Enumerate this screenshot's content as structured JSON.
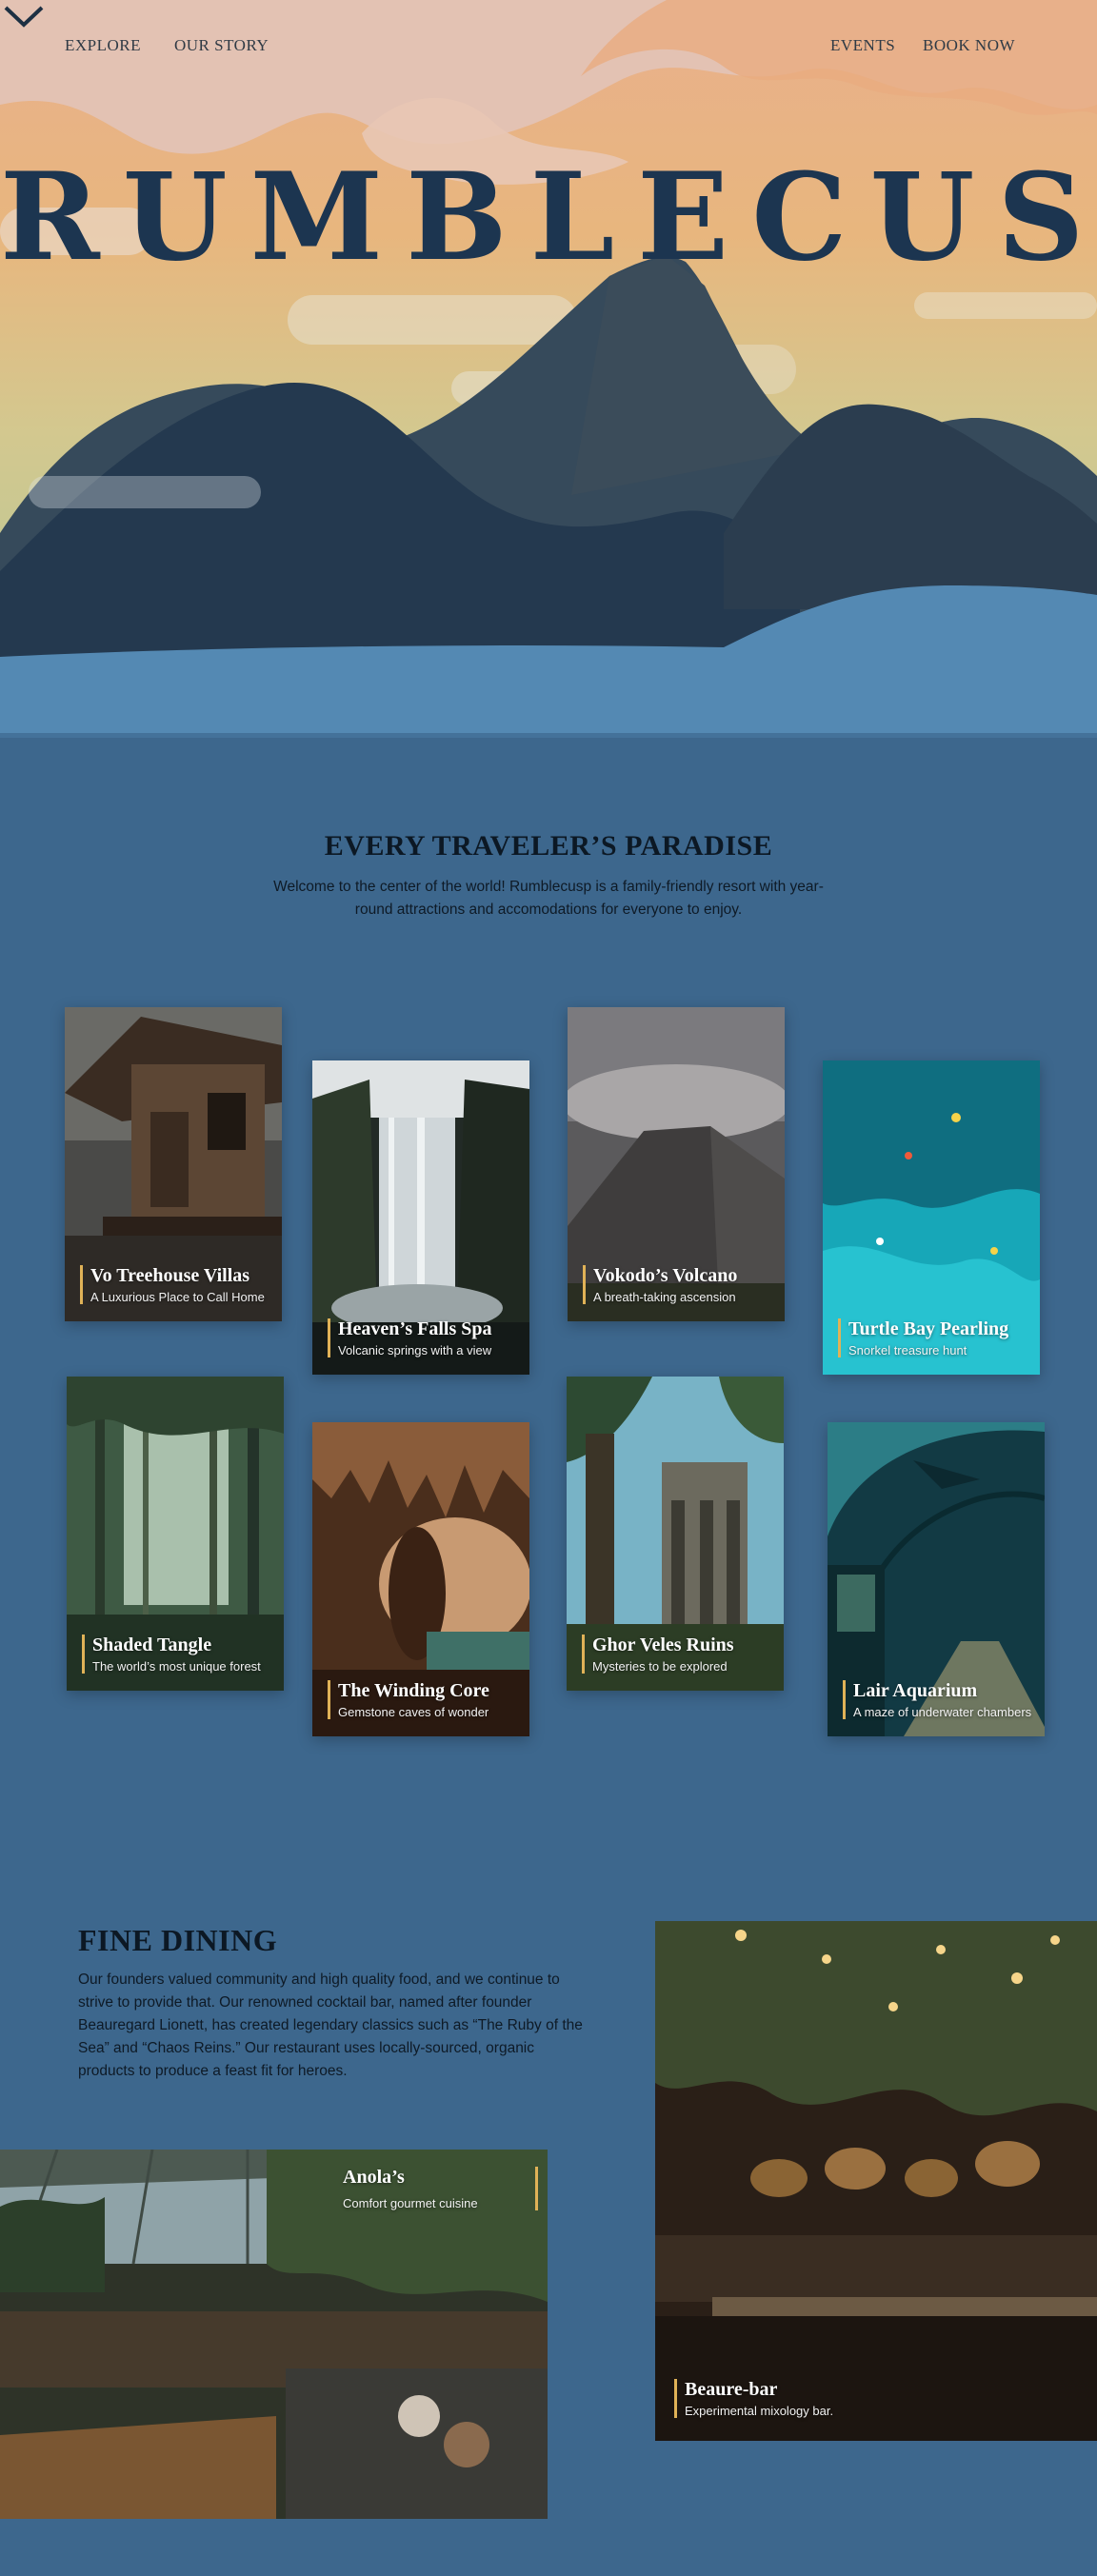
{
  "nav": {
    "explore": "EXPLORE",
    "our_story": "OUR STORY",
    "events": "EVENTS",
    "book_now": "BOOK NOW"
  },
  "hero": {
    "brand": "RUMBLECUSP"
  },
  "paradise": {
    "title": "EVERY TRAVELER’S PARADISE",
    "intro": "Welcome to the center of the world! Rumblecusp is a family-friendly resort with year-round attractions and accomodations for everyone to enjoy."
  },
  "attractions": [
    {
      "title": "Vo Treehouse Villas",
      "subtitle": "A Luxurious Place to Call Home"
    },
    {
      "title": "Heaven’s Falls Spa",
      "subtitle": "Volcanic springs with a view"
    },
    {
      "title": "Vokodo’s Volcano",
      "subtitle": "A breath-taking ascension"
    },
    {
      "title": "Turtle Bay Pearling",
      "subtitle": "Snorkel treasure hunt"
    },
    {
      "title": "Shaded Tangle",
      "subtitle": "The world’s most unique forest"
    },
    {
      "title": "The Winding Core",
      "subtitle": "Gemstone caves of wonder"
    },
    {
      "title": "Ghor Veles Ruins",
      "subtitle": "Mysteries to be explored"
    },
    {
      "title": "Lair Aquarium",
      "subtitle": "A maze of underwater chambers"
    }
  ],
  "dining": {
    "title": "FINE DINING",
    "text": "Our founders valued community and high quality food, and we continue to strive to provide that. Our renowned cocktail bar, named after founder Beauregard Lionett, has created legendary classics such as “The Ruby of the Sea” and “Chaos Reins.” Our restaurant uses locally-sourced, organic products to produce a feast fit for heroes.",
    "venues": [
      {
        "title": "Beaure-bar",
        "subtitle": "Experimental mixology bar."
      },
      {
        "title": "Anola’s",
        "subtitle": "Comfort gourmet cuisine"
      }
    ]
  },
  "colors": {
    "page_bg": "#3d678d",
    "accent": "#e0b257",
    "brand_text": "#1c3550",
    "lake": "#5489b3"
  }
}
